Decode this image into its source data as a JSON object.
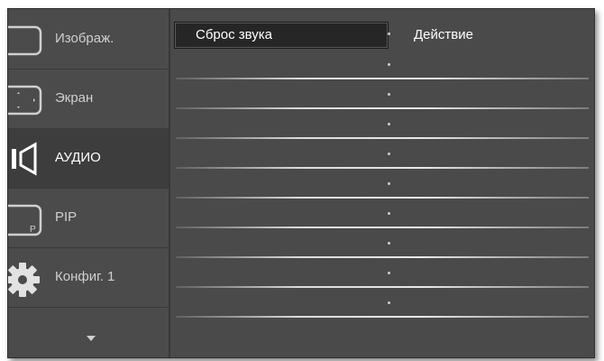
{
  "sidebar": {
    "items": [
      {
        "label": "Изображ.",
        "icon": "picture-icon"
      },
      {
        "label": "Экран",
        "icon": "screen-icon"
      },
      {
        "label": "АУДИО",
        "icon": "speaker-icon",
        "active": true
      },
      {
        "label": "PIP",
        "icon": "pip-icon",
        "icon_text": "P"
      },
      {
        "label": "Конфиг. 1",
        "icon": "gear-icon"
      }
    ],
    "scroll_icon": "scroll-down-icon"
  },
  "main": {
    "rows": [
      {
        "label": "Сброс звука",
        "value": "Действие",
        "selected": true
      },
      {
        "label": "",
        "value": ""
      },
      {
        "label": "",
        "value": ""
      },
      {
        "label": "",
        "value": ""
      },
      {
        "label": "",
        "value": ""
      },
      {
        "label": "",
        "value": ""
      },
      {
        "label": "",
        "value": ""
      },
      {
        "label": "",
        "value": ""
      },
      {
        "label": "",
        "value": ""
      },
      {
        "label": "",
        "value": ""
      }
    ]
  },
  "colors": {
    "panel": "#4a4a4a",
    "active_item": "#3d3d3d",
    "selection": "#262626",
    "text": "#ffffff"
  }
}
